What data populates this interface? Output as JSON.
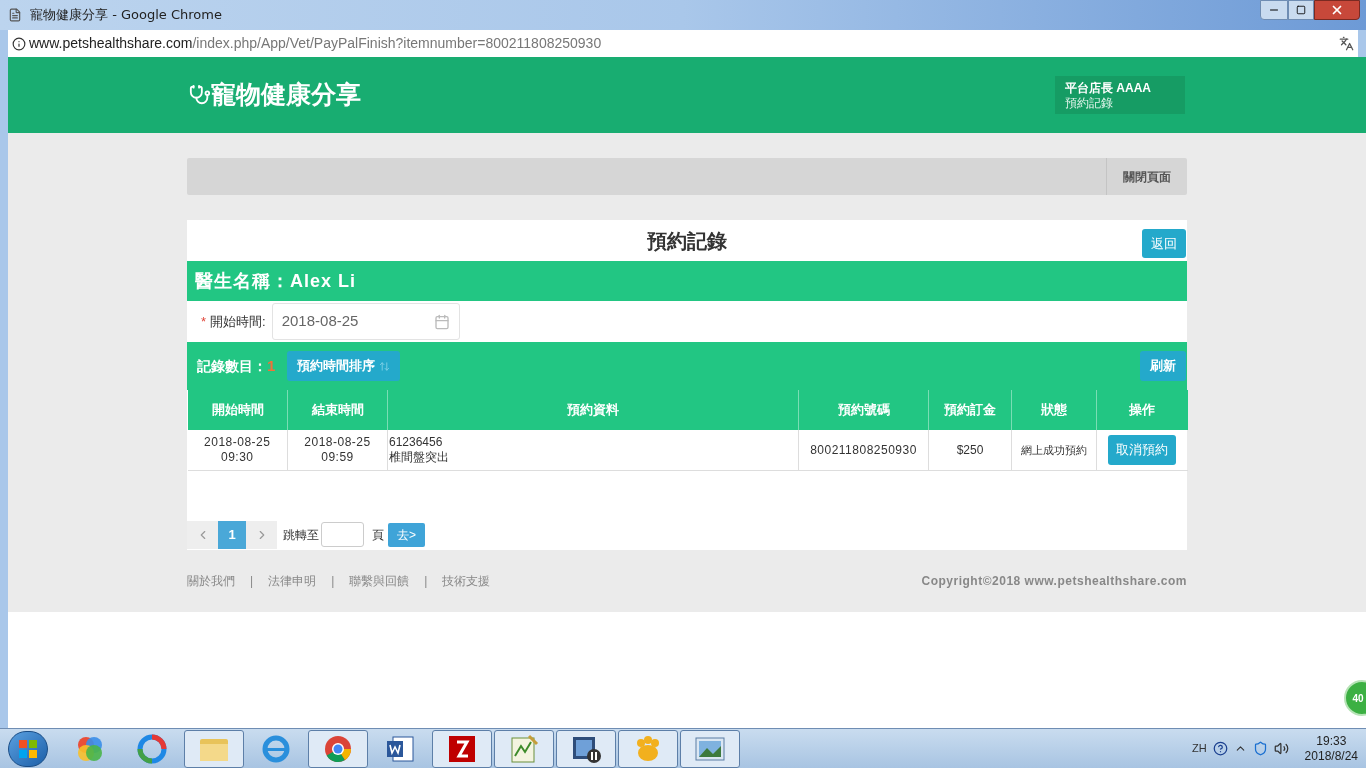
{
  "window": {
    "title": "寵物健康分享 - Google Chrome"
  },
  "address": {
    "domain": "www.petshealthshare.com",
    "path": "/index.php/App/Vet/PayPalFinish?itemnumber=800211808250930"
  },
  "header": {
    "logo": "寵物健康分享",
    "user_name": "平台店長 AAAA",
    "user_link": "預約記錄"
  },
  "toolbar": {
    "close_button": "關閉頁面"
  },
  "panel": {
    "title": "預約記錄",
    "back_button": "返回",
    "vet_label": "醫生名稱：Alex Li"
  },
  "filter": {
    "required_mark": "*",
    "label": "開始時間:",
    "value": "2018-08-25"
  },
  "records": {
    "count_label": "記錄數目：",
    "count": "1",
    "sort_button": "預約時間排序",
    "refresh_button": "刷新"
  },
  "table": {
    "columns": [
      "開始時間",
      "結束時間",
      "預約資料",
      "預約號碼",
      "預約訂金",
      "狀態",
      "操作"
    ],
    "rows": [
      {
        "start": [
          "2018-08-25",
          "09:30"
        ],
        "end": [
          "2018-08-25",
          "09:59"
        ],
        "info": [
          "61236456",
          "椎間盤突出"
        ],
        "number": "800211808250930",
        "deposit": "$250",
        "status": "網上成功預約",
        "action": "取消預約"
      }
    ]
  },
  "pagination": {
    "pages": [
      {
        "label": "1",
        "selected": true
      }
    ],
    "jump_label": "跳轉至",
    "jump_suffix": "頁",
    "go_button": "去>"
  },
  "footer": {
    "items": [
      {
        "kind": "link",
        "text": "關於我們"
      },
      {
        "kind": "separator",
        "text": "|"
      },
      {
        "kind": "link",
        "text": "法律申明"
      },
      {
        "kind": "separator",
        "text": "|"
      },
      {
        "kind": "link",
        "text": "聯繫與回饋"
      },
      {
        "kind": "separator",
        "text": "|"
      },
      {
        "kind": "link",
        "text": "技術支援"
      }
    ],
    "copyright": "Copyright©2018 www.petshealthshare.com"
  },
  "floating_badge": "40",
  "taskbar": {
    "apps": [
      {
        "kind": "balls",
        "running": false
      },
      {
        "kind": "swirl",
        "running": false
      },
      {
        "kind": "folder",
        "running": true
      },
      {
        "kind": "ie",
        "running": false
      },
      {
        "kind": "chrome",
        "running": true
      },
      {
        "kind": "word",
        "running": false
      },
      {
        "kind": "filezilla",
        "running": true
      },
      {
        "kind": "notepad",
        "running": true
      },
      {
        "kind": "video",
        "running": true
      },
      {
        "kind": "paw",
        "running": true
      },
      {
        "kind": "picture",
        "running": true
      }
    ],
    "language": "ZH",
    "time": "19:33",
    "date": "2018/8/24"
  }
}
